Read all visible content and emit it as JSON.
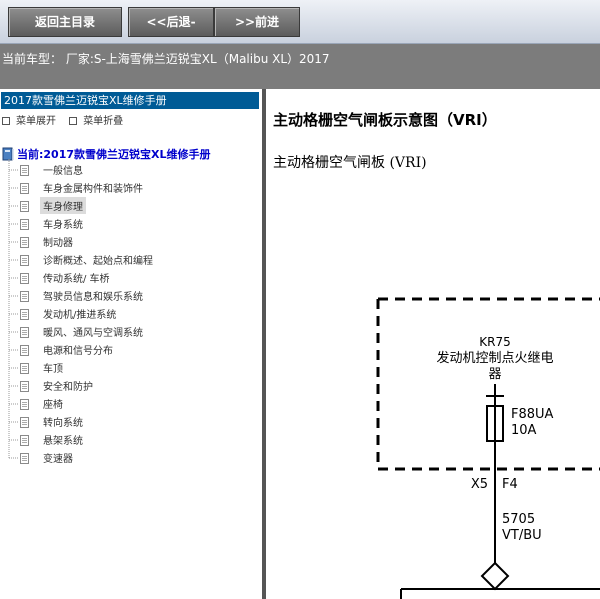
{
  "toolbar": {
    "home_label": "返回主目录",
    "back_label": "<<后退-",
    "forward_label": ">>前进"
  },
  "vehicle": {
    "current_model": "当前车型： 厂家:S-上海雪佛兰迈锐宝XL（Malibu XL）2017"
  },
  "sidebar": {
    "header": "2017款雪佛兰迈锐宝XL维修手册",
    "expand_label": "菜单展开",
    "collapse_label": "菜单折叠",
    "root_label": "当前:2017款雪佛兰迈锐宝XL维修手册",
    "items": [
      {
        "label": "一般信息"
      },
      {
        "label": "车身金属构件和装饰件"
      },
      {
        "label": "车身修理"
      },
      {
        "label": "车身系统"
      },
      {
        "label": "制动器"
      },
      {
        "label": "诊断概述、起始点和编程"
      },
      {
        "label": "传动系统/ 车桥"
      },
      {
        "label": "驾驶员信息和娱乐系统"
      },
      {
        "label": "发动机/推进系统"
      },
      {
        "label": "暖风、通风与空调系统"
      },
      {
        "label": "电源和信号分布"
      },
      {
        "label": "车顶"
      },
      {
        "label": "安全和防护"
      },
      {
        "label": "座椅"
      },
      {
        "label": "转向系统"
      },
      {
        "label": "悬架系统"
      },
      {
        "label": "变速器"
      }
    ],
    "selected_index": 2
  },
  "content": {
    "title": "主动格栅空气闸板示意图（VRI）",
    "subtitle": "主动格栅空气闸板 (VRI)",
    "diagram": {
      "relay_code": "KR75",
      "relay_name_line1": "发动机控制点火继电",
      "relay_name_line2": "器",
      "fuse_name": "F88UA",
      "fuse_rating": "10A",
      "connector_left": "X5",
      "connector_right": "F4",
      "circuit_number": "5705",
      "wire_color": "VT/BU"
    }
  }
}
